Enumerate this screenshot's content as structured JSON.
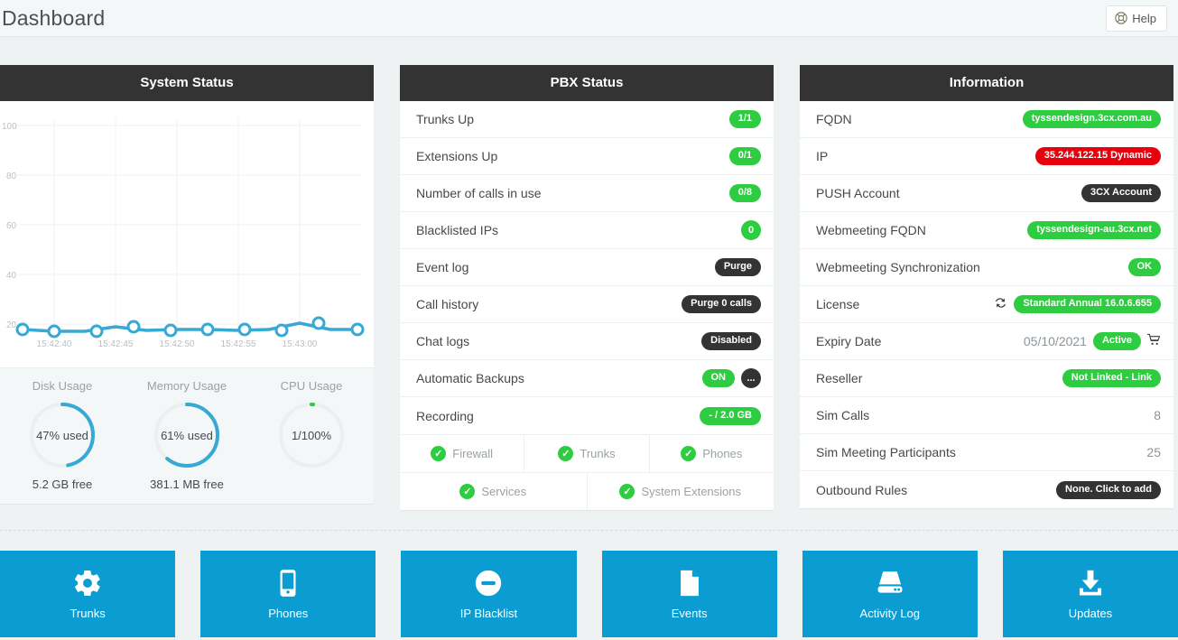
{
  "header": {
    "title": "Dashboard",
    "help_label": "Help",
    "help_icon": "lifebuoy-icon"
  },
  "system_status": {
    "title": "System Status",
    "gauges": [
      {
        "title": "Disk Usage",
        "value": "47% used",
        "sub": "5.2 GB free",
        "percent": 47
      },
      {
        "title": "Memory Usage",
        "value": "61% used",
        "sub": "381.1 MB free",
        "percent": 61
      },
      {
        "title": "CPU Usage",
        "value": "1/100%",
        "sub": "",
        "percent": 1
      }
    ]
  },
  "pbx_status": {
    "title": "PBX Status",
    "rows": [
      {
        "label": "Trunks Up",
        "badge": "1/1",
        "style": "green"
      },
      {
        "label": "Extensions Up",
        "badge": "0/1",
        "style": "green"
      },
      {
        "label": "Number of calls in use",
        "badge": "0/8",
        "style": "green"
      },
      {
        "label": "Blacklisted IPs",
        "badge": "0",
        "style": "green circle"
      },
      {
        "label": "Event log",
        "badge": "Purge",
        "style": "dark"
      },
      {
        "label": "Call history",
        "badge": "Purge 0 calls",
        "style": "dark"
      },
      {
        "label": "Chat logs",
        "badge": "Disabled",
        "style": "dark"
      },
      {
        "label": "Automatic Backups",
        "badge": "ON",
        "style": "green",
        "badge2": "...",
        "badge2_style": "dark circle"
      },
      {
        "label": "Recording",
        "badge": "- / 2.0 GB",
        "style": "green"
      }
    ],
    "services": [
      {
        "label": "Firewall",
        "icon": "check-circle-icon"
      },
      {
        "label": "Trunks",
        "icon": "check-circle-icon"
      },
      {
        "label": "Phones",
        "icon": "check-circle-icon"
      },
      {
        "label": "Services",
        "icon": "check-circle-icon"
      },
      {
        "label": "System Extensions",
        "icon": "check-circle-icon"
      }
    ]
  },
  "information": {
    "title": "Information",
    "rows": [
      {
        "label": "FQDN",
        "badge": "tyssendesign.3cx.com.au",
        "style": "green"
      },
      {
        "label": "IP",
        "badge": "35.244.122.15 Dynamic",
        "style": "red"
      },
      {
        "label": "PUSH Account",
        "badge": "3CX Account",
        "style": "dark"
      },
      {
        "label": "Webmeeting FQDN",
        "badge": "tyssendesign-au.3cx.net",
        "style": "green"
      },
      {
        "label": "Webmeeting Synchronization",
        "badge": "OK",
        "style": "green"
      },
      {
        "label": "License",
        "badge": "Standard Annual 16.0.6.655",
        "style": "green",
        "icon": "refresh-icon"
      },
      {
        "label": "Expiry Date",
        "text": "05/10/2021",
        "badge": "Active",
        "style": "green",
        "trailing_icon": "cart-icon"
      },
      {
        "label": "Reseller",
        "badge": "Not Linked - Link",
        "style": "green"
      },
      {
        "label": "Sim Calls",
        "plain": "8"
      },
      {
        "label": "Sim Meeting Participants",
        "plain": "25"
      },
      {
        "label": "Outbound Rules",
        "badge": "None. Click to add",
        "style": "dark"
      }
    ]
  },
  "tiles": [
    {
      "label": "Trunks",
      "icon": "gear-icon"
    },
    {
      "label": "Phones",
      "icon": "mobile-phone-icon"
    },
    {
      "label": "IP Blacklist",
      "icon": "minus-circle-icon"
    },
    {
      "label": "Events",
      "icon": "document-icon"
    },
    {
      "label": "Activity Log",
      "icon": "hard-drive-icon"
    },
    {
      "label": "Updates",
      "icon": "download-icon"
    }
  ],
  "colors": {
    "accent_blue": "#0b9dd1",
    "chart_line": "#36a9d4",
    "green": "#2ecc40",
    "red": "#e8000d",
    "dark": "#333333"
  },
  "chart_data": {
    "type": "line",
    "title": "System Status",
    "xlabel": "",
    "ylabel": "",
    "ylim": [
      0,
      100
    ],
    "yticks": [
      20,
      40,
      60,
      80,
      100
    ],
    "grid": true,
    "legend": "none",
    "x": [
      "15:42:38",
      "15:42:40",
      "15:42:42",
      "15:42:44",
      "15:42:46",
      "15:42:48",
      "15:42:50",
      "15:42:53",
      "15:42:55",
      "15:42:58",
      "15:43:02"
    ],
    "xticks": [
      "15:42:40",
      "15:42:45",
      "15:42:50",
      "15:42:55",
      "15:43:00"
    ],
    "series": [
      {
        "name": "CPU",
        "values": [
          1,
          1,
          1,
          2,
          1,
          1,
          1,
          1,
          1,
          3,
          1
        ]
      }
    ]
  }
}
